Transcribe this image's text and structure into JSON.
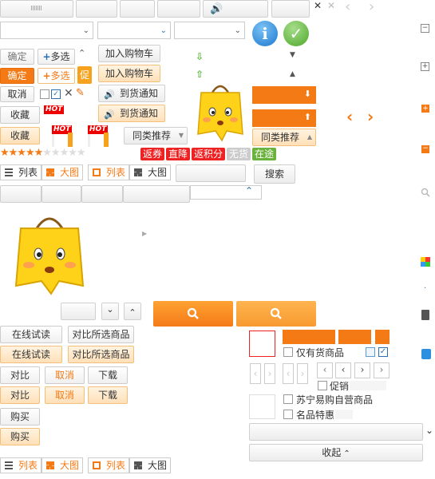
{
  "tabs": {
    "plus": "+",
    "minus": "−"
  },
  "buttons": {
    "confirm": "确定",
    "multi": "多选",
    "cancel": "取消",
    "favorite": "收藏",
    "add_cart": "加入购物车",
    "notify": "到货通知",
    "similar": "同类推荐",
    "promo": "促",
    "search": "搜索",
    "collapse": "收起"
  },
  "tags": {
    "coupon": "返券",
    "direct": "直降",
    "points": "返积分",
    "nogoods": "无货",
    "transit": "在途"
  },
  "hot": "HOT",
  "view": {
    "list": "列表",
    "big": "大图"
  },
  "filter": {
    "only_stock": "仅有货商品",
    "self_op": "苏宁易购自营商品",
    "promo": "促销",
    "specials": "名品特惠"
  },
  "actions": {
    "try_online": "在线试读",
    "compare_selected": "对比所选商品",
    "compare": "对比",
    "cancel": "取消",
    "download": "下载",
    "buy": "购买"
  },
  "colors": {
    "orange": "#f47a16",
    "orange_light": "#ffe0b8",
    "blue_info": "#2d8fe0",
    "green_ok": "#5bb33d",
    "red_tag": "#e00",
    "grey_tag": "#ccc",
    "green_tag": "#69b23c"
  },
  "rating": {
    "filled": 5,
    "total": 10
  }
}
